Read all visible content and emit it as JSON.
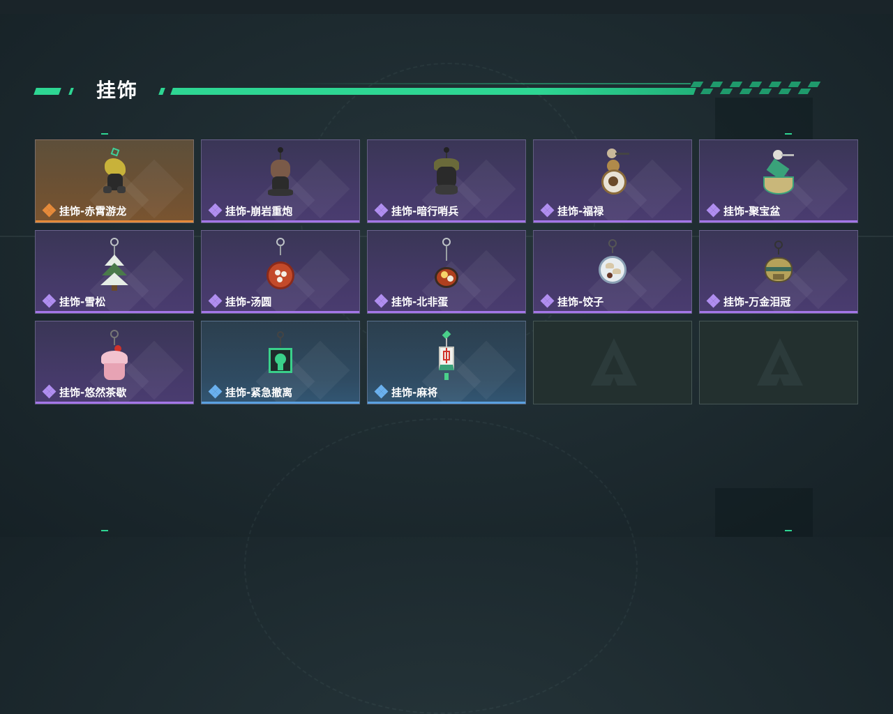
{
  "header": {
    "title": "挂饰"
  },
  "items": [
    {
      "label": "挂饰-赤霄游龙",
      "rarity": "orange",
      "icon": "dragon-charm-icon"
    },
    {
      "label": "挂饰-崩岩重炮",
      "rarity": "purple",
      "icon": "rock-cannon-charm-icon"
    },
    {
      "label": "挂饰-暗行哨兵",
      "rarity": "purple",
      "icon": "sentinel-charm-icon"
    },
    {
      "label": "挂饰-福禄",
      "rarity": "purple",
      "icon": "gourd-charm-icon"
    },
    {
      "label": "挂饰-聚宝盆",
      "rarity": "purple",
      "icon": "treasure-bowl-charm-icon"
    },
    {
      "label": "挂饰-雪松",
      "rarity": "purple",
      "icon": "snow-pine-charm-icon"
    },
    {
      "label": "挂饰-汤圆",
      "rarity": "purple",
      "icon": "tangyuan-charm-icon"
    },
    {
      "label": "挂饰-北非蛋",
      "rarity": "purple",
      "icon": "shakshuka-charm-icon"
    },
    {
      "label": "挂饰-饺子",
      "rarity": "purple",
      "icon": "dumpling-charm-icon"
    },
    {
      "label": "挂饰-万金泪冠",
      "rarity": "purple",
      "icon": "crown-charm-icon"
    },
    {
      "label": "挂饰-悠然茶歇",
      "rarity": "purple",
      "icon": "cupcake-charm-icon"
    },
    {
      "label": "挂饰-紧急撤离",
      "rarity": "blue",
      "icon": "exit-sign-charm-icon"
    },
    {
      "label": "挂饰-麻将",
      "rarity": "blue",
      "icon": "mahjong-charm-icon"
    },
    {
      "label": "",
      "rarity": "empty",
      "icon": "delta-logo-icon"
    },
    {
      "label": "",
      "rarity": "empty",
      "icon": "delta-logo-icon"
    }
  ],
  "colors": {
    "accent": "#2ed693",
    "orange": "#e58a3a",
    "purple": "#a476e8",
    "blue": "#5aa0e0"
  }
}
